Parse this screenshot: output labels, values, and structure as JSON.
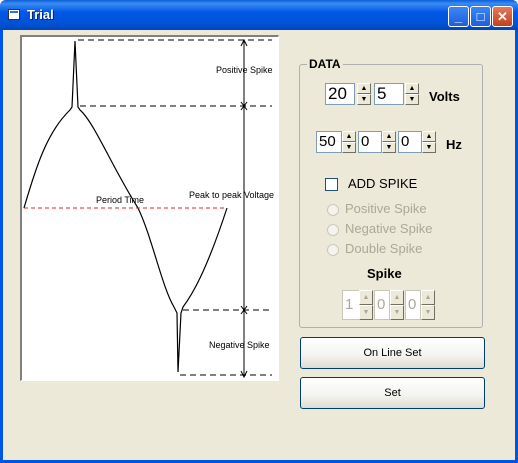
{
  "window": {
    "title": "Trial"
  },
  "graph": {
    "positive_spike": "Positive Spike",
    "period_time": "Period Time",
    "peak_to_peak": "Peak to peak Voltage",
    "negative_spike": "Negative Spike"
  },
  "data_group": {
    "title": "DATA",
    "volts": {
      "whole": "20",
      "fraction": "5",
      "unit": "Volts"
    },
    "hz": {
      "a": "50",
      "b": "0",
      "c": "0",
      "unit": "Hz"
    }
  },
  "add_spike": {
    "label": "ADD SPIKE",
    "checked": false
  },
  "spike_type": {
    "options": [
      "Positive Spike",
      "Negative Spike",
      "Double Spike"
    ],
    "enabled": false
  },
  "spike": {
    "title": "Spike",
    "a": "1",
    "b": "0",
    "c": "0"
  },
  "buttons": {
    "online_set": "On Line Set",
    "set": "Set"
  }
}
